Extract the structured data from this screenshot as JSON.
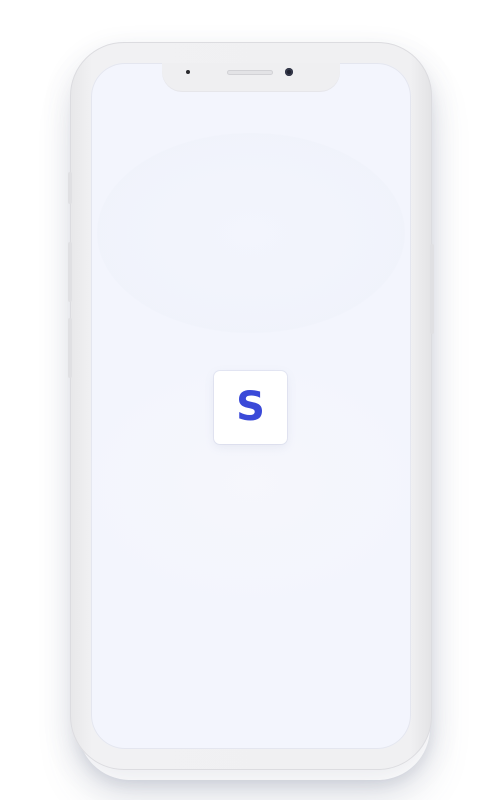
{
  "device": {
    "type": "smartphone",
    "frame_color": "#efeff1",
    "screen_color": "#f3f5fd"
  },
  "splash": {
    "logo_letter": "S",
    "logo_color": "#3a49d8",
    "tile_color": "#ffffff"
  }
}
